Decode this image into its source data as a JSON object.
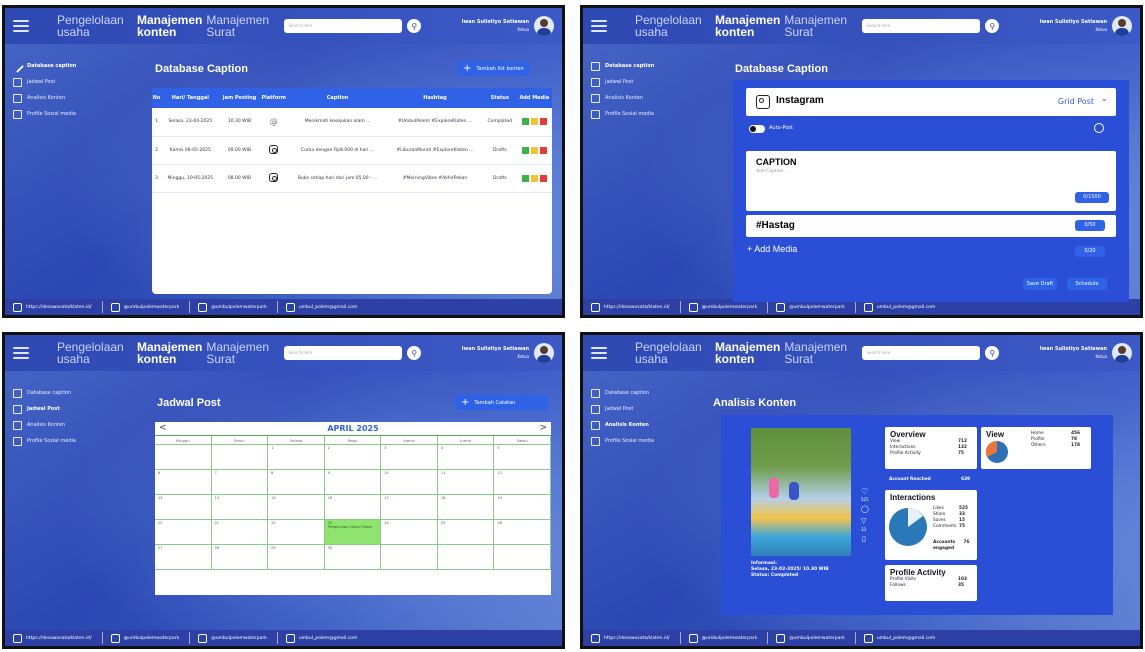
{
  "common": {
    "nav_pengelolaan": "Pengelolaan usaha",
    "nav_konten_1": "Manajemen",
    "nav_konten_2": "konten",
    "nav_surat": "Manajemen Surat",
    "search_placeholder": "Search here",
    "user_name": "Iwan Sulistiyo Setiawan",
    "user_role": "Ketua",
    "sidebar": [
      "Database caption",
      "Jadwal Post",
      "Analisis Konten",
      "Profile Sosial media"
    ],
    "footer_site": "https://desawusata/klaten.id/",
    "footer_youtube": "@umbulpolemwaterpark",
    "footer_instagram": "@umbulpolemwaterpark",
    "footer_email": "umbul_polem@gmail.com"
  },
  "panel1": {
    "title": "Database Caption",
    "add_button": "Tambah list konten",
    "columns": [
      "No",
      "Hari/ Tanggal",
      "Jam Posting",
      "Platform",
      "Caption",
      "Hashtag",
      "Status",
      "Add Media"
    ],
    "rows": [
      {
        "no": "1",
        "date": "Selasa, 23-04-2025",
        "time": "10.30 WIB",
        "platform": "threads",
        "caption": "Menikmati kesejukan alam ...",
        "hashtag": "#UmbulPolem #ExploreKlaten ...",
        "status": "Complated"
      },
      {
        "no": "2",
        "date": "Kamis 08-05-2025",
        "time": "09.00 WIB",
        "platform": "instagram",
        "caption": "Cuma dengan Rp8.000 di hari ...",
        "hashtag": "#LiburanMurah #ExploreKlaten ...",
        "status": "Drafts"
      },
      {
        "no": "3",
        "date": "Minggu, 10-05-2025",
        "time": "08.00 WIB",
        "platform": "instagram",
        "caption": "Buka setiap hari dari jam 05.00 - ...",
        "hashtag": "#MorningVibes #AkhirPekan",
        "status": "Drafts"
      }
    ]
  },
  "panel2": {
    "title": "Database Caption",
    "platform": "Instagram",
    "post_type": "Grid Post",
    "autopost": "Auto-Post",
    "caption_label": "CAPTION",
    "caption_placeholder": "Add Caption ...",
    "caption_count": "0/1500",
    "hashtag_label": "#Hastag",
    "hashtag_count": "0/50",
    "media_label": "Add Media",
    "media_count": "0/20",
    "save_draft": "Save Draft",
    "schedule": "Schedule"
  },
  "panel3": {
    "title": "Jadwal Post",
    "add_button": "Tambah Catatan",
    "month": "APRIL 2025",
    "days": [
      "Minggu",
      "Senin",
      "Selasa",
      "Rabu",
      "Kamis",
      "Jumat",
      "Sabtu"
    ],
    "cells": [
      "",
      "",
      "1",
      "2",
      "3",
      "4",
      "5",
      "6",
      "7",
      "8",
      "9",
      "10",
      "11",
      "12",
      "13",
      "14",
      "15",
      "16",
      "17",
      "18",
      "19",
      "20",
      "21",
      "22",
      "23",
      "24",
      "25",
      "26",
      "27",
      "28",
      "29",
      "30",
      "",
      "",
      ""
    ],
    "event_day": "23",
    "event_text": "Pengenalan Umbul Polem"
  },
  "panel4": {
    "title": "Analisis Konten",
    "photo_caption_1": "Informasi:",
    "photo_caption_2": "Selasa, 23-02-2025/ 10.30 WIB",
    "photo_caption_3": "Status: Completed",
    "side_count_1": "525",
    "side_count_2": "33",
    "overview_title": "Overview",
    "overview_rows": [
      [
        "View",
        "712"
      ],
      [
        "Interactions",
        "132"
      ],
      [
        "Profile Activity",
        "75"
      ]
    ],
    "account_reached": "Account Reached",
    "account_reached_val": "639",
    "view_title": "View",
    "view_rows": [
      [
        "Home",
        "456"
      ],
      [
        "Profile",
        "78"
      ],
      [
        "Others",
        "178"
      ]
    ],
    "interactions_title": "Interactions",
    "interactions_rows": [
      [
        "Likes",
        "525"
      ],
      [
        "Share",
        "33"
      ],
      [
        "Saves",
        "15"
      ],
      [
        "Comments",
        "75"
      ]
    ],
    "accounts_engaged": "Accounts engaged",
    "accounts_engaged_val": "76",
    "profile_title": "Profile Activity",
    "profile_rows": [
      [
        "Profile Visits",
        "103"
      ],
      [
        "Follows",
        "35"
      ]
    ]
  },
  "colors": {
    "primary": "#2f62e6",
    "topbar": "#2f49b3",
    "event": "#8fe36f"
  }
}
